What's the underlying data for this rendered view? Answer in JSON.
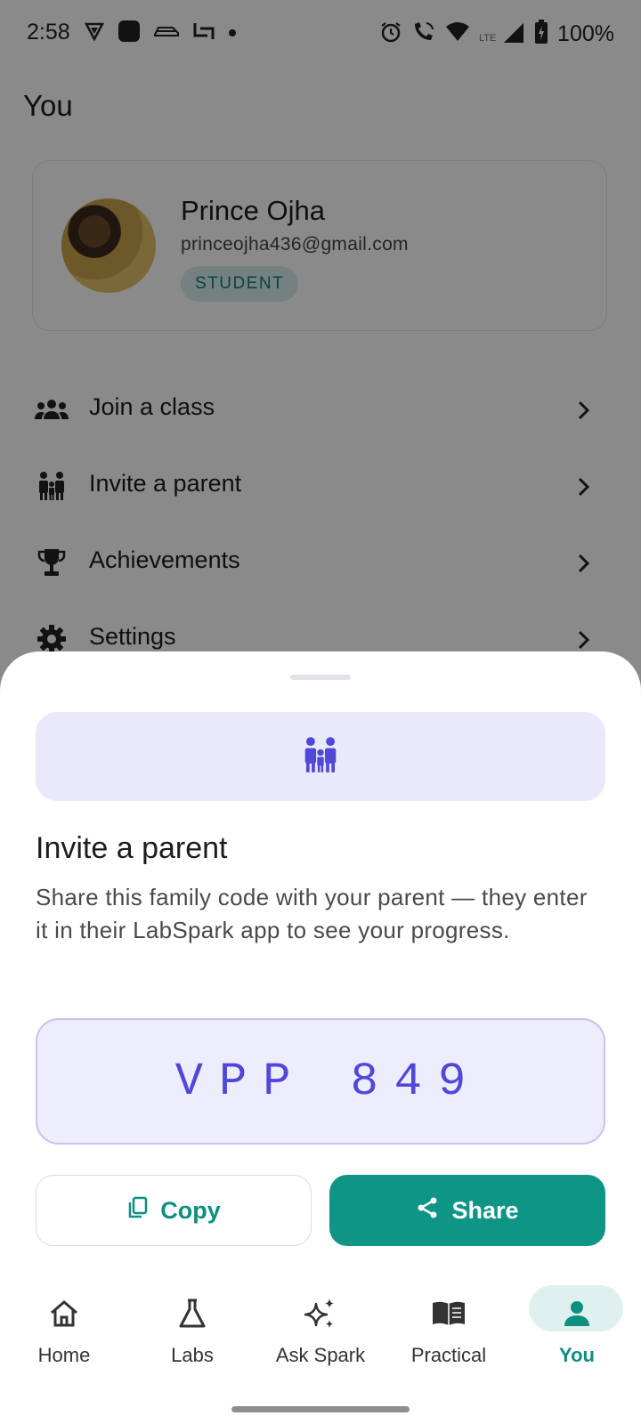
{
  "status_bar": {
    "time": "2:58",
    "battery": "100%",
    "network": "LTE",
    "left_icons": [
      "vpn-icon",
      "app-icon",
      "car-icon",
      "screenshot-icon",
      "dot-icon"
    ],
    "right_icons": [
      "alarm-icon",
      "wifi-calling-icon",
      "wifi-icon",
      "lte-signal-icon",
      "battery-icon"
    ]
  },
  "page": {
    "title": "You"
  },
  "profile": {
    "name": "Prince Ojha",
    "email": "princeojha436@gmail.com",
    "role": "STUDENT"
  },
  "menu": {
    "items": [
      {
        "label": "Join a class",
        "icon": "groups-icon"
      },
      {
        "label": "Invite a parent",
        "icon": "family-icon"
      },
      {
        "label": "Achievements",
        "icon": "trophy-icon"
      },
      {
        "label": "Settings",
        "icon": "gear-icon"
      }
    ]
  },
  "sheet": {
    "icon": "family-icon",
    "title": "Invite a parent",
    "description": "Share this family code with your parent — they enter it in their LabSpark app to see your progress.",
    "code": "VPP 849",
    "copy_label": "Copy",
    "share_label": "Share"
  },
  "bottom_nav": {
    "items": [
      {
        "label": "Home",
        "icon": "home-icon"
      },
      {
        "label": "Labs",
        "icon": "flask-icon"
      },
      {
        "label": "Ask Spark",
        "icon": "sparkle-icon"
      },
      {
        "label": "Practical",
        "icon": "book-icon"
      },
      {
        "label": "You",
        "icon": "person-icon"
      }
    ],
    "active": "You"
  },
  "colors": {
    "accent_teal": "#0e9585",
    "accent_indigo": "#4f48d8",
    "hero_bg": "#eae9fb",
    "scrim": "rgba(0,0,0,0.46)"
  }
}
